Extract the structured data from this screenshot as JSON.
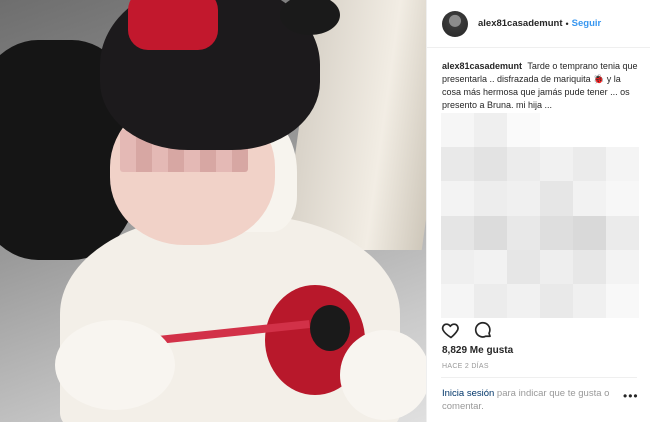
{
  "post": {
    "username": "alex81casademunt",
    "separator": "•",
    "follow_label": "Seguir",
    "caption_text": "Tarde o temprano tenia que presentarla .. disfrazada de mariquita 🐞 y la cosa más hermosa que jamás pude tener ... os presento a Bruna. mi hija ...",
    "likes": "8,829 Me gusta",
    "timestamp": "HACE 2 DÍAS",
    "login_link": "Inicia sesión",
    "login_text": " para indicar que te gusta o comentar.",
    "more_label": "•••"
  },
  "icons": {
    "like": "heart-icon",
    "comment": "comment-icon",
    "more": "more-options-icon"
  },
  "colors": {
    "accent": "#3897f0",
    "link": "#003569",
    "muted": "#999999",
    "text": "#262626",
    "border": "#efefef"
  }
}
